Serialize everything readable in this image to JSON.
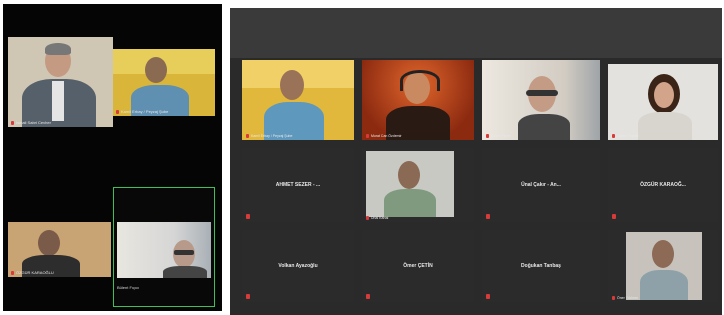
{
  "left_meeting": {
    "participants": [
      {
        "name": "İsmail Sabri Cevher",
        "active": false
      },
      {
        "name": "Kamil Erbay / Peyzaj Şube",
        "active": false
      },
      {
        "name": "ÖZGÜR KARAOĞLU",
        "active": false
      },
      {
        "name": "Bülent Fıçıcı",
        "active": true
      }
    ]
  },
  "right_meeting": {
    "video_participants": [
      {
        "name": "Kamil Erbay / Peyzaj Şube",
        "active": false
      },
      {
        "name": "Murat Can Özdemir",
        "active": false
      },
      {
        "name": "Bülent Fıçıcı",
        "active": true
      },
      {
        "name": "Özlem Toprak",
        "active": false
      },
      {
        "name": "Ünal Kartal",
        "active": false
      },
      {
        "name": "Öner Yıldırım",
        "active": false
      }
    ],
    "name_tiles": [
      {
        "name": "AHMET SEZER - ..."
      },
      {
        "name": "Ünal Çakır - An..."
      },
      {
        "name": "ÖZGÜR KARAOĞ..."
      },
      {
        "name": "Volkan Ayazoğlu"
      },
      {
        "name": "Ömer ÇETİN"
      },
      {
        "name": "Doğukan Tanbaş"
      }
    ]
  },
  "colors": {
    "active_border_right": "#e9d24c",
    "active_border_left": "#3fbf56",
    "mic_muted": "#d83a3a"
  }
}
